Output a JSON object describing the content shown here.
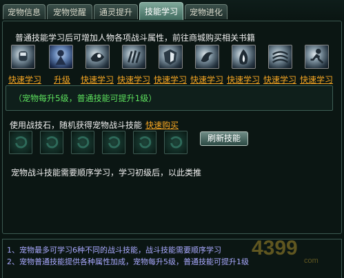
{
  "tabs": [
    {
      "label": "宠物信息",
      "active": false
    },
    {
      "label": "宠物觉醒",
      "active": false
    },
    {
      "label": "通灵提升",
      "active": false
    },
    {
      "label": "技能学习",
      "active": true
    },
    {
      "label": "宠物进化",
      "active": false
    }
  ],
  "learn": {
    "headline": "普通技能学习后可增加人物各项战斗属性，前往商城购买相关书籍",
    "skills": [
      {
        "icon": "skill-fist-icon",
        "action": "快速学习"
      },
      {
        "icon": "skill-warrior-icon",
        "action": "升级"
      },
      {
        "icon": "skill-beast-icon",
        "action": "快速学习"
      },
      {
        "icon": "skill-claw-icon",
        "action": "快速学习"
      },
      {
        "icon": "skill-shield-icon",
        "action": "快速学习"
      },
      {
        "icon": "skill-swirl-icon",
        "action": "快速学习"
      },
      {
        "icon": "skill-flame-icon",
        "action": "快速学习"
      },
      {
        "icon": "skill-wind-icon",
        "action": "快速学习"
      },
      {
        "icon": "skill-runner-icon",
        "action": "快速学习"
      }
    ],
    "info": "（宠物每升5级，普通技能可提升1级）"
  },
  "battle": {
    "label": "使用战技石，随机获得宠物战斗技能",
    "buy_label": "快速购买",
    "refresh_label": "刷新技能",
    "note": "宠物战斗技能需要顺序学习，学习初级后，以此类推",
    "slot_count": 6
  },
  "footer": {
    "line1": "1、宠物最多可学习6种不同的战斗技能，战斗技能需要顺序学习",
    "line2": "2、宠物普通技能提供各种属性加成，宠物每升5级，普通技能可提升1级"
  },
  "watermark": {
    "text": "4399",
    "sub": "com"
  },
  "colors": {
    "link": "#f5a623",
    "info_green": "#5de05d",
    "footer_blue": "#a9a9ff"
  }
}
